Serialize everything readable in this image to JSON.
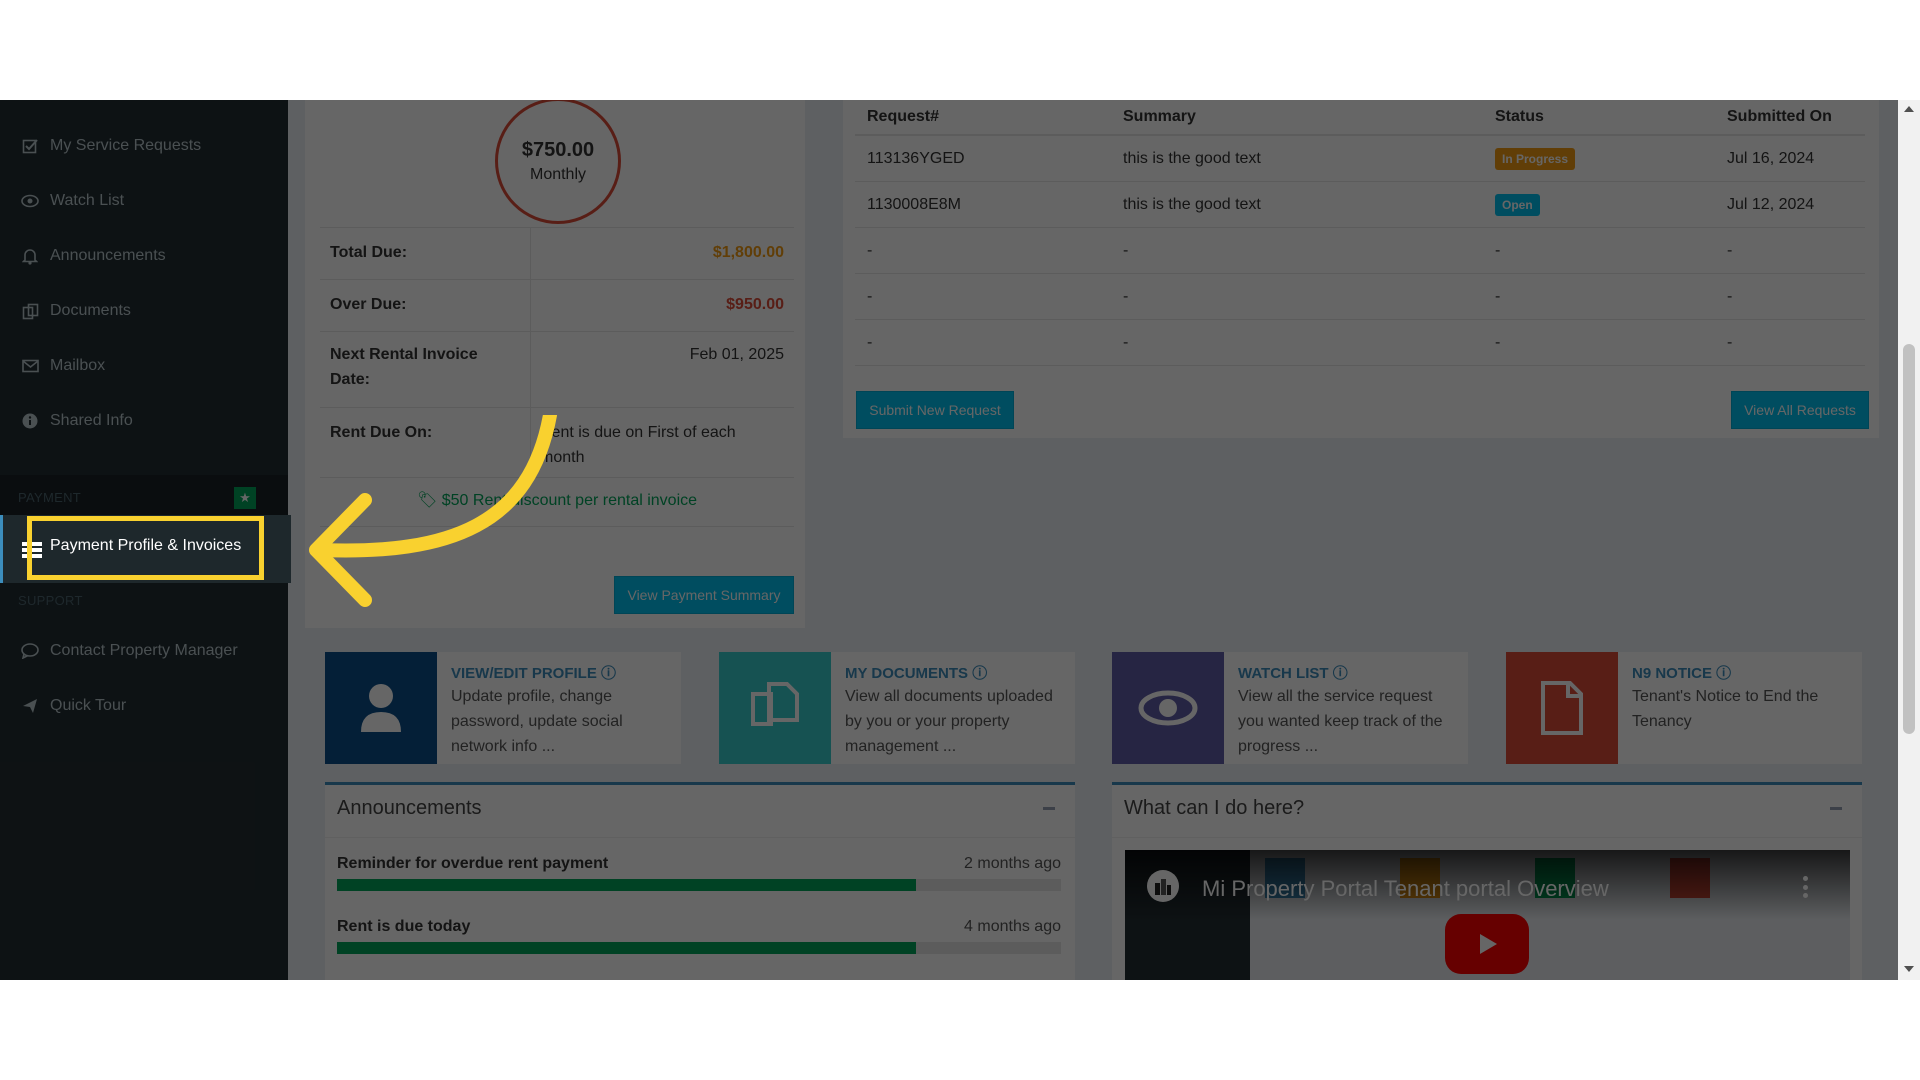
{
  "sidebar": {
    "items": [
      {
        "label": "My Service Requests",
        "icon": "check-square-icon"
      },
      {
        "label": "Watch List",
        "icon": "eye-icon"
      },
      {
        "label": "Announcements",
        "icon": "bell-icon"
      },
      {
        "label": "Documents",
        "icon": "copy-icon"
      },
      {
        "label": "Mailbox",
        "icon": "envelope-icon"
      },
      {
        "label": "Shared Info",
        "icon": "info-circle-icon"
      }
    ],
    "payment_header": "PAYMENT",
    "payment_item": "Payment Profile & Invoices",
    "support_header": "SUPPORT",
    "support_items": [
      {
        "label": "Contact Property Manager",
        "icon": "comment-icon"
      },
      {
        "label": "Quick Tour",
        "icon": "plane-icon"
      }
    ]
  },
  "payment": {
    "amount": "$750.00",
    "period": "Monthly",
    "total_due_label": "Total Due:",
    "total_due_value": "$1,800.00",
    "over_due_label": "Over Due:",
    "over_due_value": "$950.00",
    "next_invoice_label": "Next Rental Invoice Date:",
    "next_invoice_value": "Feb 01, 2025",
    "rent_due_label": "Rent Due On:",
    "rent_due_value": "Rent is due on First of each month",
    "discount": "$50 Rent discount per rental invoice",
    "view_summary_button": "View Payment Summary"
  },
  "requests": {
    "headers": [
      "Request#",
      "Summary",
      "Status",
      "Submitted On"
    ],
    "rows": [
      {
        "id": "113136YGED",
        "summary": "this is the good text",
        "status": "In Progress",
        "date": "Jul 16, 2024"
      },
      {
        "id": "1130008E8M",
        "summary": "this is the good text",
        "status": "Open",
        "date": "Jul 12, 2024"
      },
      {
        "id": "-",
        "summary": "-",
        "status": "-",
        "date": "-"
      },
      {
        "id": "-",
        "summary": "-",
        "status": "-",
        "date": "-"
      },
      {
        "id": "-",
        "summary": "-",
        "status": "-",
        "date": "-"
      }
    ],
    "submit_button": "Submit New Request",
    "view_all_button": "View All Requests"
  },
  "info_boxes": [
    {
      "title": "VIEW/EDIT PROFILE",
      "desc": "Update profile, change password, update social network info ...",
      "color": "#0b4f8a",
      "icon": "user-icon"
    },
    {
      "title": "MY DOCUMENTS",
      "desc": "View all documents uploaded by you or your property management ...",
      "color": "#39cccc",
      "icon": "copy-icon"
    },
    {
      "title": "WATCH LIST",
      "desc": "View all the service request you wanted keep track of the progress ...",
      "color": "#605ca8",
      "icon": "eye-icon"
    },
    {
      "title": "N9 NOTICE",
      "desc": "Tenant's Notice to End the Tenancy",
      "color": "#dd4b39",
      "icon": "file-icon"
    }
  ],
  "announcements": {
    "title": "Announcements",
    "items": [
      {
        "text": "Reminder for overdue rent payment",
        "age": "2 months ago",
        "progress": 0.8
      },
      {
        "text": "Rent is due today",
        "age": "4 months ago",
        "progress": 0.8
      }
    ]
  },
  "help": {
    "title": "What can I do here?",
    "video_title": "Mi Property Portal Tenant portal Overview"
  },
  "colors": {
    "sidebar_bg": "#222d32",
    "accent": "#3c8dbc",
    "highlight": "#f9d12f",
    "success": "#00a65a",
    "danger": "#dd4b39"
  }
}
